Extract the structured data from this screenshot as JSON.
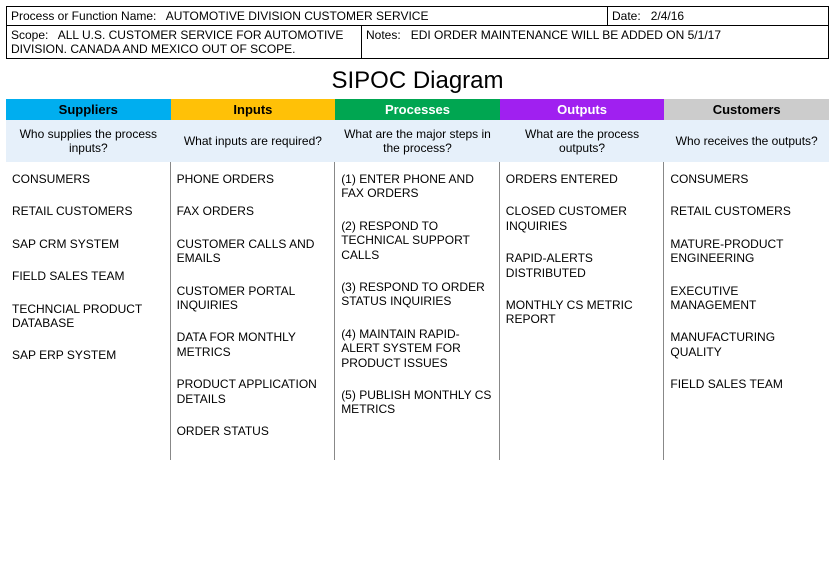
{
  "header": {
    "processNameLabel": "Process or Function Name:",
    "processName": "AUTOMOTIVE DIVISION CUSTOMER SERVICE",
    "dateLabel": "Date:",
    "date": "2/4/16",
    "scopeLabel": "Scope:",
    "scope": "ALL U.S. CUSTOMER SERVICE FOR AUTOMOTIVE DIVISION. CANADA AND MEXICO OUT OF SCOPE.",
    "notesLabel": "Notes:",
    "notes": "EDI ORDER MAINTENANCE WILL BE ADDED ON 5/1/17"
  },
  "title": "SIPOC Diagram",
  "columns": {
    "suppliers": {
      "header": "Suppliers",
      "question": "Who supplies the process inputs?",
      "items": [
        "CONSUMERS",
        "RETAIL CUSTOMERS",
        "SAP CRM SYSTEM",
        "FIELD SALES TEAM",
        "TECHNCIAL PRODUCT DATABASE",
        "SAP ERP SYSTEM"
      ]
    },
    "inputs": {
      "header": "Inputs",
      "question": "What inputs are required?",
      "items": [
        "PHONE ORDERS",
        "FAX ORDERS",
        "CUSTOMER CALLS AND EMAILS",
        "CUSTOMER PORTAL INQUIRIES",
        "DATA FOR MONTHLY METRICS",
        "PRODUCT APPLICATION DETAILS",
        "ORDER STATUS"
      ]
    },
    "processes": {
      "header": "Processes",
      "question": "What are the major steps in the process?",
      "items": [
        "(1) ENTER PHONE AND FAX ORDERS",
        "(2) RESPOND TO TECHNICAL SUPPORT CALLS",
        "(3) RESPOND TO ORDER STATUS INQUIRIES",
        "(4) MAINTAIN RAPID-ALERT SYSTEM FOR PRODUCT ISSUES",
        "(5) PUBLISH MONTHLY CS METRICS"
      ]
    },
    "outputs": {
      "header": "Outputs",
      "question": "What are the process outputs?",
      "items": [
        "ORDERS ENTERED",
        "CLOSED CUSTOMER INQUIRIES",
        "RAPID-ALERTS DISTRIBUTED",
        "MONTHLY CS METRIC REPORT"
      ]
    },
    "customers": {
      "header": "Customers",
      "question": "Who receives the outputs?",
      "items": [
        "CONSUMERS",
        "RETAIL CUSTOMERS",
        "MATURE-PRODUCT ENGINEERING",
        "EXECUTIVE MANAGEMENT",
        "MANUFACTURING QUALITY",
        "FIELD SALES TEAM"
      ]
    }
  }
}
